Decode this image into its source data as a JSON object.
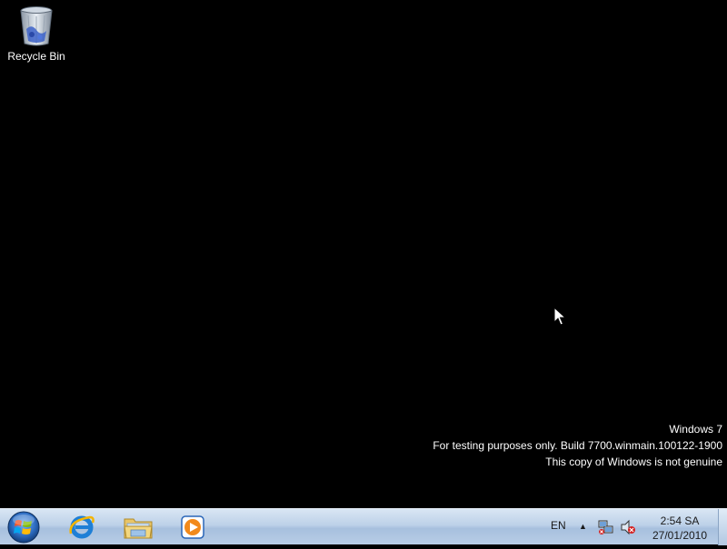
{
  "desktop": {
    "icons": [
      {
        "label": "Recycle Bin",
        "icon": "recycle-bin-icon"
      }
    ]
  },
  "watermark": {
    "line1": "Windows 7",
    "line2": "For testing purposes only. Build 7700.winmain.100122-1900",
    "line3": "This copy of Windows is not genuine"
  },
  "taskbar": {
    "start_icon": "windows-logo-icon",
    "pinned": [
      {
        "icon": "internet-explorer-icon"
      },
      {
        "icon": "windows-explorer-icon"
      },
      {
        "icon": "windows-media-player-icon"
      }
    ],
    "tray": {
      "language": "EN",
      "show_hidden_icon": "up-arrow-icon",
      "network_icon": "network-icon",
      "volume_icon": "volume-muted-icon",
      "time": "2:54 SA",
      "date": "27/01/2010"
    }
  },
  "colors": {
    "desktop_background": "#000000",
    "taskbar": "#bdd1e8",
    "watermark_text": "#ffffff"
  }
}
